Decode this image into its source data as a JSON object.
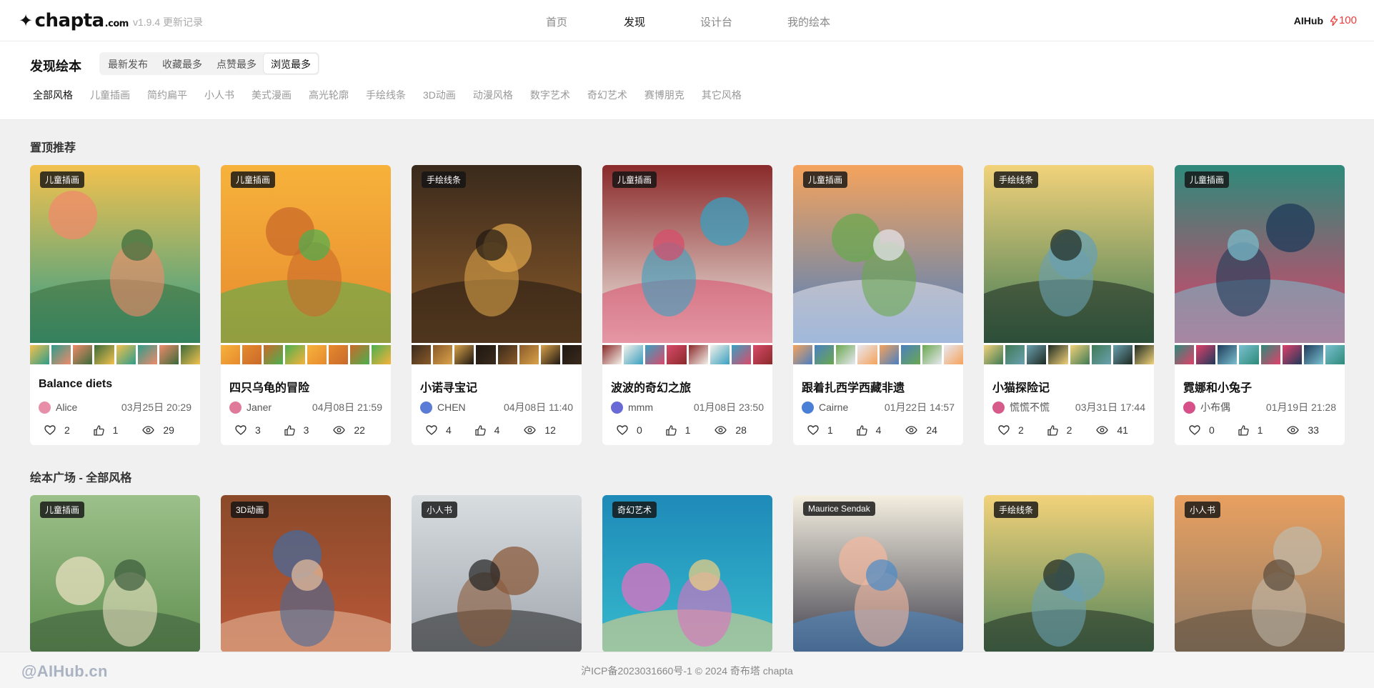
{
  "header": {
    "logo_text": "chapta",
    "logo_suffix": ".com",
    "version": "v1.9.4 更新记录",
    "nav": [
      "首页",
      "发现",
      "设计台",
      "我的绘本"
    ],
    "active_nav": "发现",
    "brand": "AIHub",
    "credits": "100"
  },
  "filters": {
    "title": "发现绘本",
    "sort_tabs": [
      "最新发布",
      "收藏最多",
      "点赞最多",
      "浏览最多"
    ],
    "active_sort": "浏览最多",
    "styles": [
      "全部风格",
      "儿童插画",
      "简约扁平",
      "小人书",
      "美式漫画",
      "高光轮廓",
      "手绘线条",
      "3D动画",
      "动漫风格",
      "数字艺术",
      "奇幻艺术",
      "赛博朋克",
      "其它风格"
    ],
    "active_style": "全部风格"
  },
  "pinned": {
    "heading": "置顶推荐",
    "cards": [
      {
        "badge": "儿童插画",
        "title": "Balance diets",
        "author": "Alice",
        "date": "03月25日 20:29",
        "favorites": "2",
        "likes": "1",
        "views": "29",
        "palette": [
          "#f2c14e",
          "#2e9c8a",
          "#f08a6b",
          "#3a6b3a"
        ],
        "avatar": "#e78fa8"
      },
      {
        "badge": "儿童插画",
        "title": "四只乌龟的冒险",
        "author": "Janer",
        "date": "04月08日 21:59",
        "favorites": "3",
        "likes": "3",
        "views": "22",
        "palette": [
          "#f7b23b",
          "#e68a2e",
          "#c96a2a",
          "#4caf50"
        ],
        "avatar": "#e07a9a"
      },
      {
        "badge": "手绘线条",
        "title": "小诺寻宝记",
        "author": "CHEN",
        "date": "04月08日 11:40",
        "favorites": "4",
        "likes": "4",
        "views": "12",
        "palette": [
          "#3a2a1c",
          "#8a5a2a",
          "#d9a24a",
          "#1f1812"
        ],
        "avatar": "#5a7bd6"
      },
      {
        "badge": "儿童插画",
        "title": "波波的奇幻之旅",
        "author": "mmm",
        "date": "01月08日 23:50",
        "favorites": "0",
        "likes": "1",
        "views": "28",
        "palette": [
          "#8a2a2a",
          "#f4f1ea",
          "#3aa0c0",
          "#d94a6a"
        ],
        "avatar": "#6a6ad6"
      },
      {
        "badge": "儿童插画",
        "title": "跟着扎西学西藏非遗",
        "author": "Cairne",
        "date": "01月22日 14:57",
        "favorites": "1",
        "likes": "4",
        "views": "24",
        "palette": [
          "#f5a35c",
          "#4a7fc1",
          "#6aa84f",
          "#e8e8f0"
        ],
        "avatar": "#4a7fd6"
      },
      {
        "badge": "手绘线条",
        "title": "小猫探险记",
        "author": "慌慌不慌",
        "date": "03月31日 17:44",
        "favorites": "2",
        "likes": "2",
        "views": "41",
        "palette": [
          "#f2d27a",
          "#3f7a55",
          "#6aa0b0",
          "#1e2a22"
        ],
        "avatar": "#d65a8a"
      },
      {
        "badge": "儿童插画",
        "title": "霓娜和小兔子",
        "author": "小布偶",
        "date": "01月19日 21:28",
        "favorites": "0",
        "likes": "1",
        "views": "33",
        "palette": [
          "#2e8a7a",
          "#e0406a",
          "#1e3a5a",
          "#7ac0d0"
        ],
        "avatar": "#d6508a"
      }
    ]
  },
  "plaza": {
    "heading": "绘本广场 - 全部风格",
    "cards": [
      {
        "badge": "儿童插画",
        "palette": [
          "#9cc08a",
          "#5a8a4a",
          "#e8e0c0",
          "#3a5a3a"
        ]
      },
      {
        "badge": "3D动画",
        "palette": [
          "#8a4a2a",
          "#c05a3a",
          "#4a6a9a",
          "#e8c0a0"
        ]
      },
      {
        "badge": "小人书",
        "palette": [
          "#d8dde0",
          "#9aa0a8",
          "#8a5a3a",
          "#222222"
        ]
      },
      {
        "badge": "奇幻艺术",
        "palette": [
          "#1e8ab8",
          "#3ac0d0",
          "#e070c0",
          "#f0d080"
        ]
      },
      {
        "badge": "Maurice Sendak",
        "palette": [
          "#f5efe0",
          "#2a2a3a",
          "#f0b8a0",
          "#4a8ac8"
        ]
      },
      {
        "badge": "手绘线条",
        "palette": [
          "#f2d27a",
          "#3f7a55",
          "#6aa0b0",
          "#1e2a22"
        ]
      },
      {
        "badge": "小人书",
        "palette": [
          "#e8a060",
          "#8a7a6a",
          "#c0b8a8",
          "#5a4a3a"
        ]
      }
    ]
  },
  "footer": {
    "copyright": "沪ICP备2023031660号-1 © 2024 奇布塔 chapta",
    "watermark": "@AIHub.cn"
  }
}
